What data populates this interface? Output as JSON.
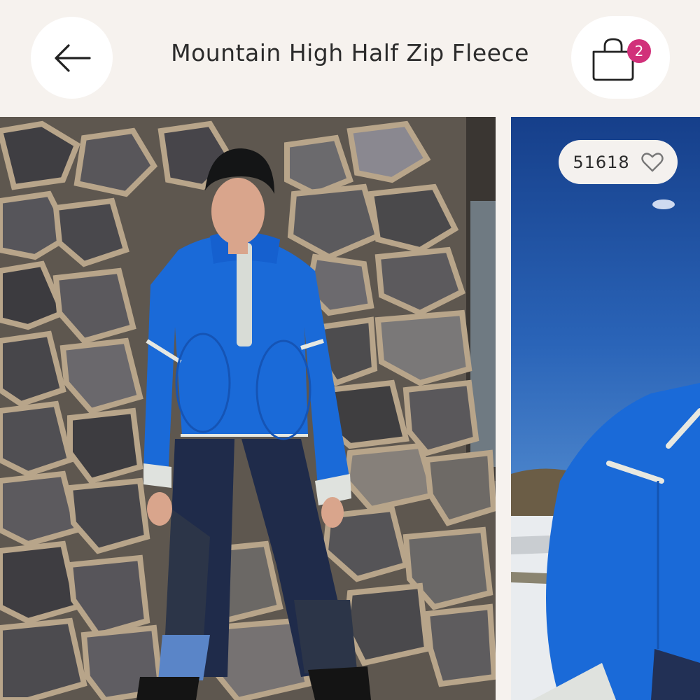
{
  "header": {
    "title": "Mountain High Half Zip Fleece",
    "back_icon": "arrow-left-icon",
    "bag_icon": "shopping-bag-icon",
    "bag_count": "2"
  },
  "gallery": {
    "images": [
      {
        "alt": "Model in blue half zip fleece leaning against stone wall"
      },
      {
        "alt": "Close-up of blue fleece against blue sky"
      }
    ],
    "likes": "51618",
    "like_icon": "heart-outline-icon"
  },
  "colors": {
    "background": "#f6f2ee",
    "badge": "#d1307a",
    "fleece_blue": "#1a6ad8"
  }
}
